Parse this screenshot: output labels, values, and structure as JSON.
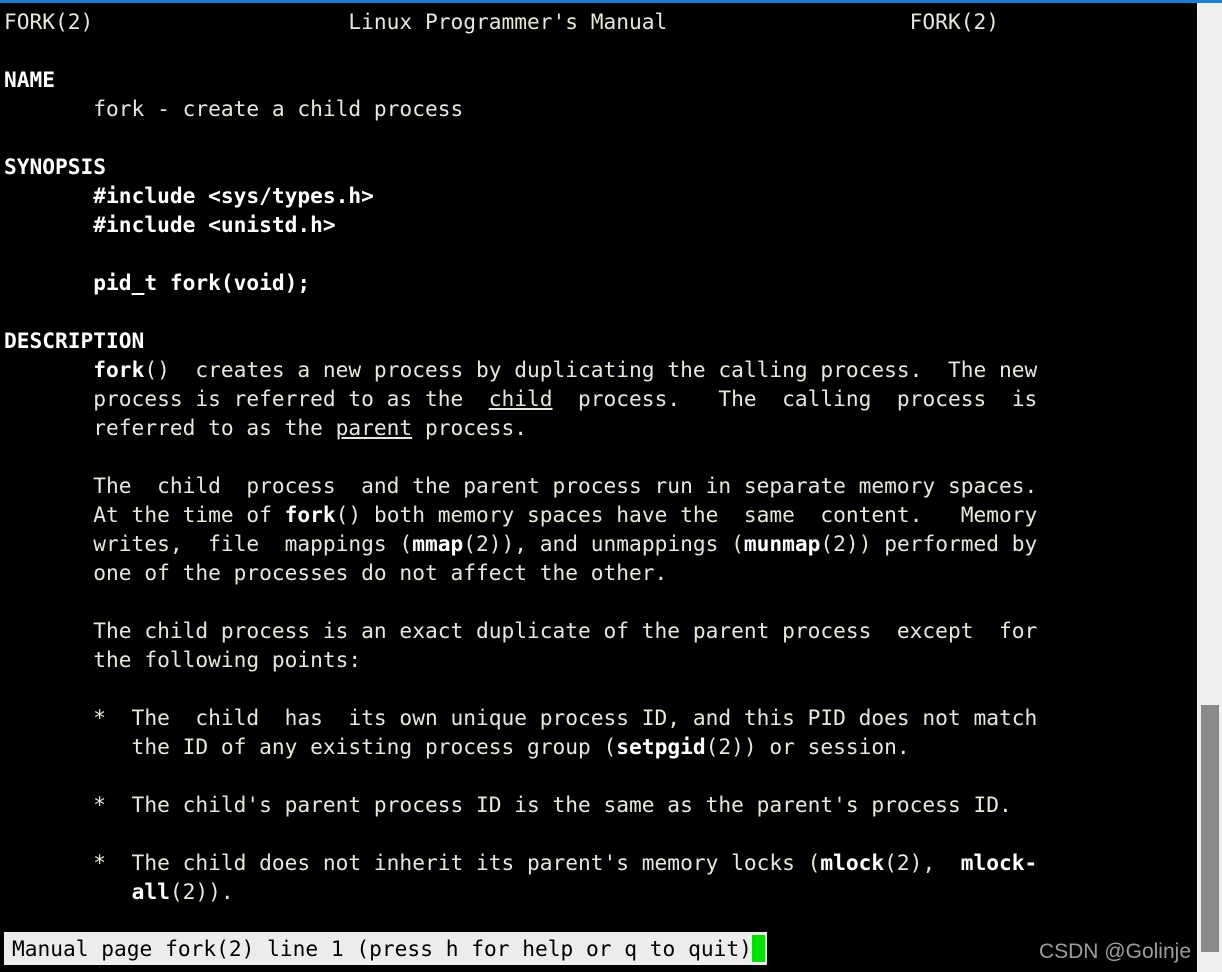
{
  "window": {
    "accent_color": "#1a7fd4",
    "background": "#000000",
    "foreground": "#e8e8d8"
  },
  "manpage": {
    "header_left": "FORK(2)",
    "header_center": "Linux Programmer's Manual",
    "header_right": "FORK(2)",
    "sections": {
      "name": "NAME",
      "synopsis": "SYNOPSIS",
      "description": "DESCRIPTION"
    },
    "lines": {
      "l01": "FORK(2)                    Linux Programmer's Manual                   FORK(2)",
      "l03": "NAME",
      "l04": "       fork - create a child process",
      "l06": "SYNOPSIS",
      "l07_include1": "#include <sys/types.h>",
      "l08_include2": "#include <unistd.h>",
      "l10_proto": "pid_t fork(void);",
      "l12": "DESCRIPTION",
      "d1_a": "fork",
      "d1_b": "()  creates a new process by duplicating the calling process.  The new",
      "d2_a": "       process is referred to as the  ",
      "d2_u": "child",
      "d2_b": "  process.   The  calling  process  is",
      "d3_a": "       referred to as the ",
      "d3_u": "parent",
      "d3_b": " process.",
      "p2_l1": "       The  child  process  and the parent process run in separate memory spaces.",
      "p2_l2_a": "       At the time of ",
      "p2_l2_bold": "fork",
      "p2_l2_b": "() both memory spaces have the  same  content.   Memory",
      "p2_l3_a": "       writes,  file  mappings (",
      "p2_l3_bold1": "mmap",
      "p2_l3_b": "(2)), and unmappings (",
      "p2_l3_bold2": "munmap",
      "p2_l3_c": "(2)) performed by",
      "p2_l4": "       one of the processes do not affect the other.",
      "p3_l1": "       The child process is an exact duplicate of the parent process  except  for",
      "p3_l2": "       the following points:",
      "b1_l1": "       *  The  child  has  its own unique process ID, and this PID does not match",
      "b1_l2_a": "          the ID of any existing process group (",
      "b1_l2_bold": "setpgid",
      "b1_l2_b": "(2)) or session.",
      "b2_l1": "       *  The child's parent process ID is the same as the parent's process ID.",
      "b3_l1_a": "       *  The child does not inherit its parent's memory locks (",
      "b3_l1_bold1": "mlock",
      "b3_l1_b": "(2),  ",
      "b3_l1_bold2": "mlock-",
      "b3_l2_bold": "all",
      "b3_l2_b": "(2))."
    }
  },
  "statusbar": {
    "text": "Manual page fork(2) line 1 (press h for help or q to quit)",
    "cursor_color": "#00e000"
  },
  "scrollbar": {
    "track_color": "#efefef",
    "thumb_color": "#8a8a8a"
  },
  "watermark": {
    "text": "CSDN @Golinje"
  }
}
